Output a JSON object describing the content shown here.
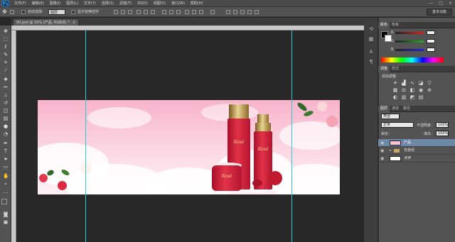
{
  "app": {
    "logo": "Ps"
  },
  "menu": [
    "文件(F)",
    "编辑(E)",
    "图像(I)",
    "图层(L)",
    "文字(Y)",
    "选择(S)",
    "滤镜(T)",
    "3D(D)",
    "视图(V)",
    "窗口(W)",
    "帮助(H)"
  ],
  "window_controls": {
    "minimize": "—",
    "maximize": "□",
    "close": "×"
  },
  "options": {
    "auto_select_label": "自动选择：",
    "auto_select_value": "图层",
    "show_transform_label": "显示变换控件"
  },
  "workspace": {
    "label": "基本功能"
  },
  "document": {
    "tab_title": "00.psd @ 50% (产品, RGB/8) *",
    "tab_close": "×"
  },
  "banner": {
    "logo_a": "Rosé",
    "logo_b": "Rosé",
    "logo_c": "Rosé"
  },
  "color_panel": {
    "tabs": [
      "颜色",
      "色板"
    ],
    "r": "R",
    "g": "G",
    "b": "B",
    "colors": {
      "foreground": "#000000",
      "background": "#ffffff",
      "r_slider": "#d22",
      "g_slider": "#2a2",
      "b_slider": "#22d"
    }
  },
  "adjust_panel": {
    "tabs": [
      "调整",
      "样式"
    ],
    "title": "添加调整"
  },
  "layers_panel": {
    "tabs": [
      "图层",
      "通道",
      "路径"
    ],
    "kind_label": "类型",
    "blend_mode": "正常",
    "opacity_label": "不透明度：",
    "opacity_value": "100%",
    "lock_label": "锁定：",
    "fill_label": "填充：",
    "fill_value": "100%",
    "layers": [
      {
        "name": "产品",
        "selected": true
      },
      {
        "name": "背景组",
        "selected": false
      },
      {
        "name": "背景",
        "selected": false
      }
    ]
  }
}
